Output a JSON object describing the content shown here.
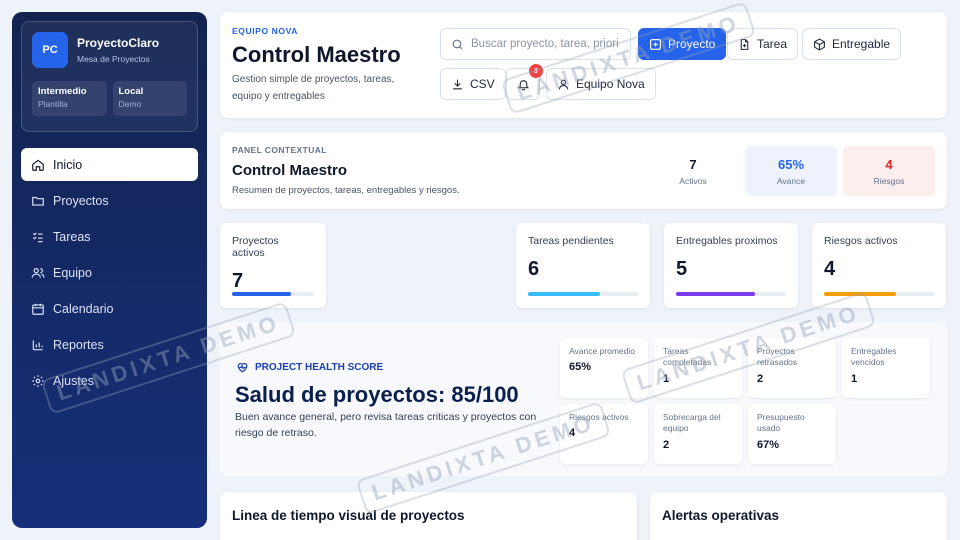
{
  "sidebar": {
    "logo": "PC",
    "brand_name": "ProyectoClaro",
    "brand_sub": "Mesa de Proyectos",
    "chips": [
      {
        "title": "Intermedio",
        "sub": "Plantilla"
      },
      {
        "title": "Local",
        "sub": "Demo"
      }
    ],
    "items": [
      {
        "label": "Inicio",
        "icon": "home-icon"
      },
      {
        "label": "Proyectos",
        "icon": "folder-icon"
      },
      {
        "label": "Tareas",
        "icon": "checklist-icon"
      },
      {
        "label": "Equipo",
        "icon": "users-icon"
      },
      {
        "label": "Calendario",
        "icon": "calendar-icon"
      },
      {
        "label": "Reportes",
        "icon": "bar-chart-icon"
      },
      {
        "label": "Ajustes",
        "icon": "gear-icon"
      }
    ]
  },
  "header": {
    "eyebrow": "EQUIPO NOVA",
    "title": "Control Maestro",
    "subtitle": "Gestion simple de proyectos, tareas, equipo y entregables",
    "search_placeholder": "Buscar proyecto, tarea, priori",
    "btn_proyecto": "Proyecto",
    "btn_tarea": "Tarea",
    "btn_entregable": "Entregable",
    "btn_csv": "CSV",
    "notifications_count": "3",
    "btn_team": "Equipo Nova"
  },
  "context": {
    "eyebrow": "PANEL CONTEXTUAL",
    "title": "Control Maestro",
    "subtitle": "Resumen de proyectos, tareas, entregables y riesgos.",
    "stats": [
      {
        "value": "7",
        "label": "Activos",
        "color": "#0f172a"
      },
      {
        "value": "65%",
        "label": "Avance",
        "color": "#2563eb"
      },
      {
        "value": "4",
        "label": "Riesgos",
        "color": "#dc2626"
      }
    ]
  },
  "kpis": [
    {
      "label": "Proyectos activos",
      "value": "7",
      "progress": 0.72,
      "color": "#2563eb"
    },
    {
      "label": "Tareas pendientes",
      "value": "6",
      "progress": 0.65,
      "color": "#38bdf8"
    },
    {
      "label": "Entregables proximos",
      "value": "5",
      "progress": 0.72,
      "color": "#7c3aed"
    },
    {
      "label": "Riesgos activos",
      "value": "4",
      "progress": 0.65,
      "color": "#f59e0b"
    }
  ],
  "health": {
    "eyebrow": "PROJECT HEALTH SCORE",
    "title": "Salud de proyectos: 85/100",
    "subtitle": "Buen avance general, pero revisa tareas criticas y proyectos con riesgo de retraso.",
    "metrics": [
      {
        "label": "Avance promedio",
        "value": "65%"
      },
      {
        "label": "Tareas completadas",
        "value": "1"
      },
      {
        "label": "Proyectos retrasados",
        "value": "2"
      },
      {
        "label": "Entregables vencidos",
        "value": "1"
      },
      {
        "label": "Riesgos activos",
        "value": "4"
      },
      {
        "label": "Sobrecarga del equipo",
        "value": "2"
      },
      {
        "label": "Presupuesto usado",
        "value": "67%"
      }
    ]
  },
  "bottom": {
    "timeline_title": "Linea de tiempo visual de proyectos",
    "alerts_title": "Alertas operativas"
  },
  "watermark": "LANDIXTA DEMO"
}
